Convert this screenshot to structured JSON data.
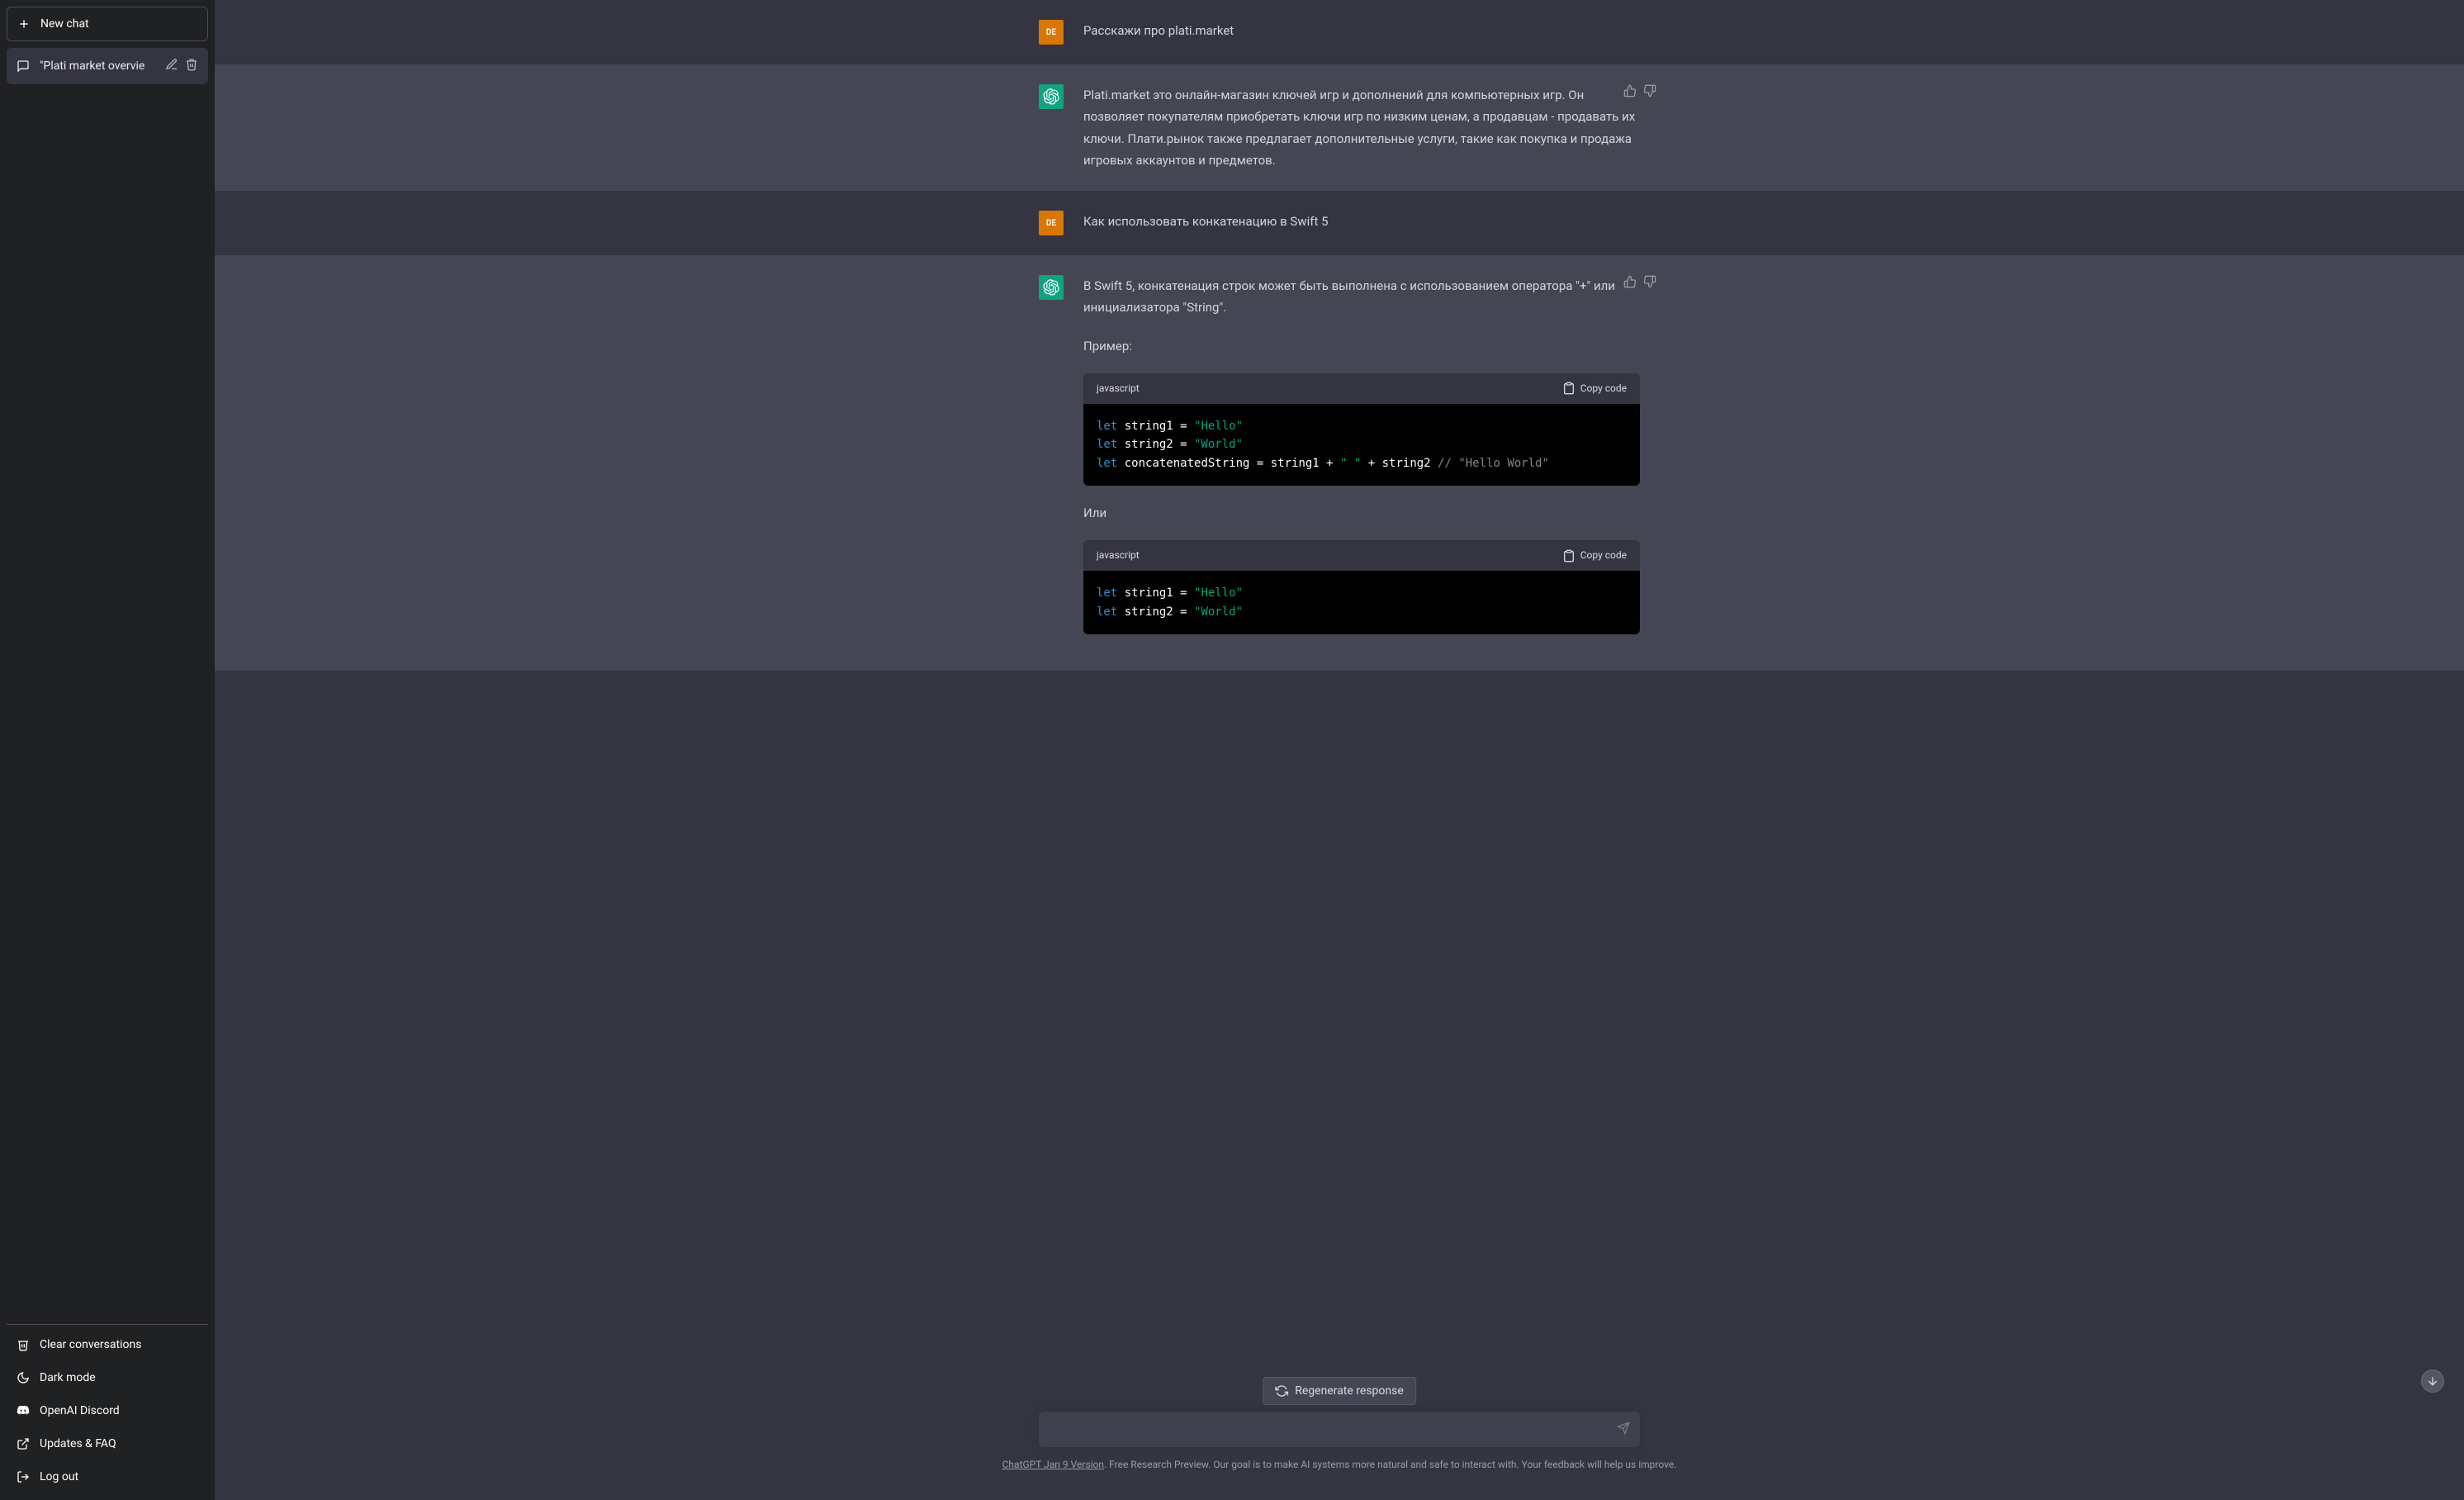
{
  "sidebar": {
    "new_chat": "New chat",
    "conversations": [
      {
        "title": "\"Plati market overvie"
      }
    ],
    "footer": {
      "clear": "Clear conversations",
      "dark_mode": "Dark mode",
      "discord": "OpenAI Discord",
      "updates": "Updates & FAQ",
      "logout": "Log out"
    }
  },
  "chat": {
    "user_initials": "DE",
    "messages": [
      {
        "role": "user",
        "text": "Расскажи про plati.market"
      },
      {
        "role": "assistant",
        "text": "Plati.market это онлайн-магазин ключей игр и дополнений для компьютерных игр. Он позволяет покупателям приобретать ключи игр по низким ценам, а продавцам - продавать их ключи. Плати.рынок также предлагает дополнительные услуги, такие как покупка и продажа игровых аккаунтов и предметов."
      },
      {
        "role": "user",
        "text": "Как использовать конкатенацию в Swift 5"
      }
    ],
    "assistant2": {
      "intro": "В Swift 5, конкатенация строк может быть выполнена с использованием оператора \"+\" или инициализатора \"String\".",
      "example_label": "Пример:",
      "or_label": "Или",
      "code_lang": "javascript",
      "copy_label": "Copy code",
      "code1": {
        "l1_kw": "let",
        "l1_var": " string1 = ",
        "l1_str": "\"Hello\"",
        "l2_kw": "let",
        "l2_var": " string2 = ",
        "l2_str": "\"World\"",
        "l3_kw": "let",
        "l3_var": " concatenatedString = string1 + ",
        "l3_str1": "\" \"",
        "l3_op": " + string2 ",
        "l3_cm": "// \"Hello World\""
      },
      "code2": {
        "l1_kw": "let",
        "l1_var": " string1 = ",
        "l1_str": "\"Hello\"",
        "l2_kw": "let",
        "l2_var": " string2 = ",
        "l2_str": "\"World\""
      }
    }
  },
  "controls": {
    "regenerate": "Regenerate response",
    "input_placeholder": ""
  },
  "footer": {
    "link": "ChatGPT Jan 9 Version",
    "text": ". Free Research Preview. Our goal is to make AI systems more natural and safe to interact with. Your feedback will help us improve."
  }
}
